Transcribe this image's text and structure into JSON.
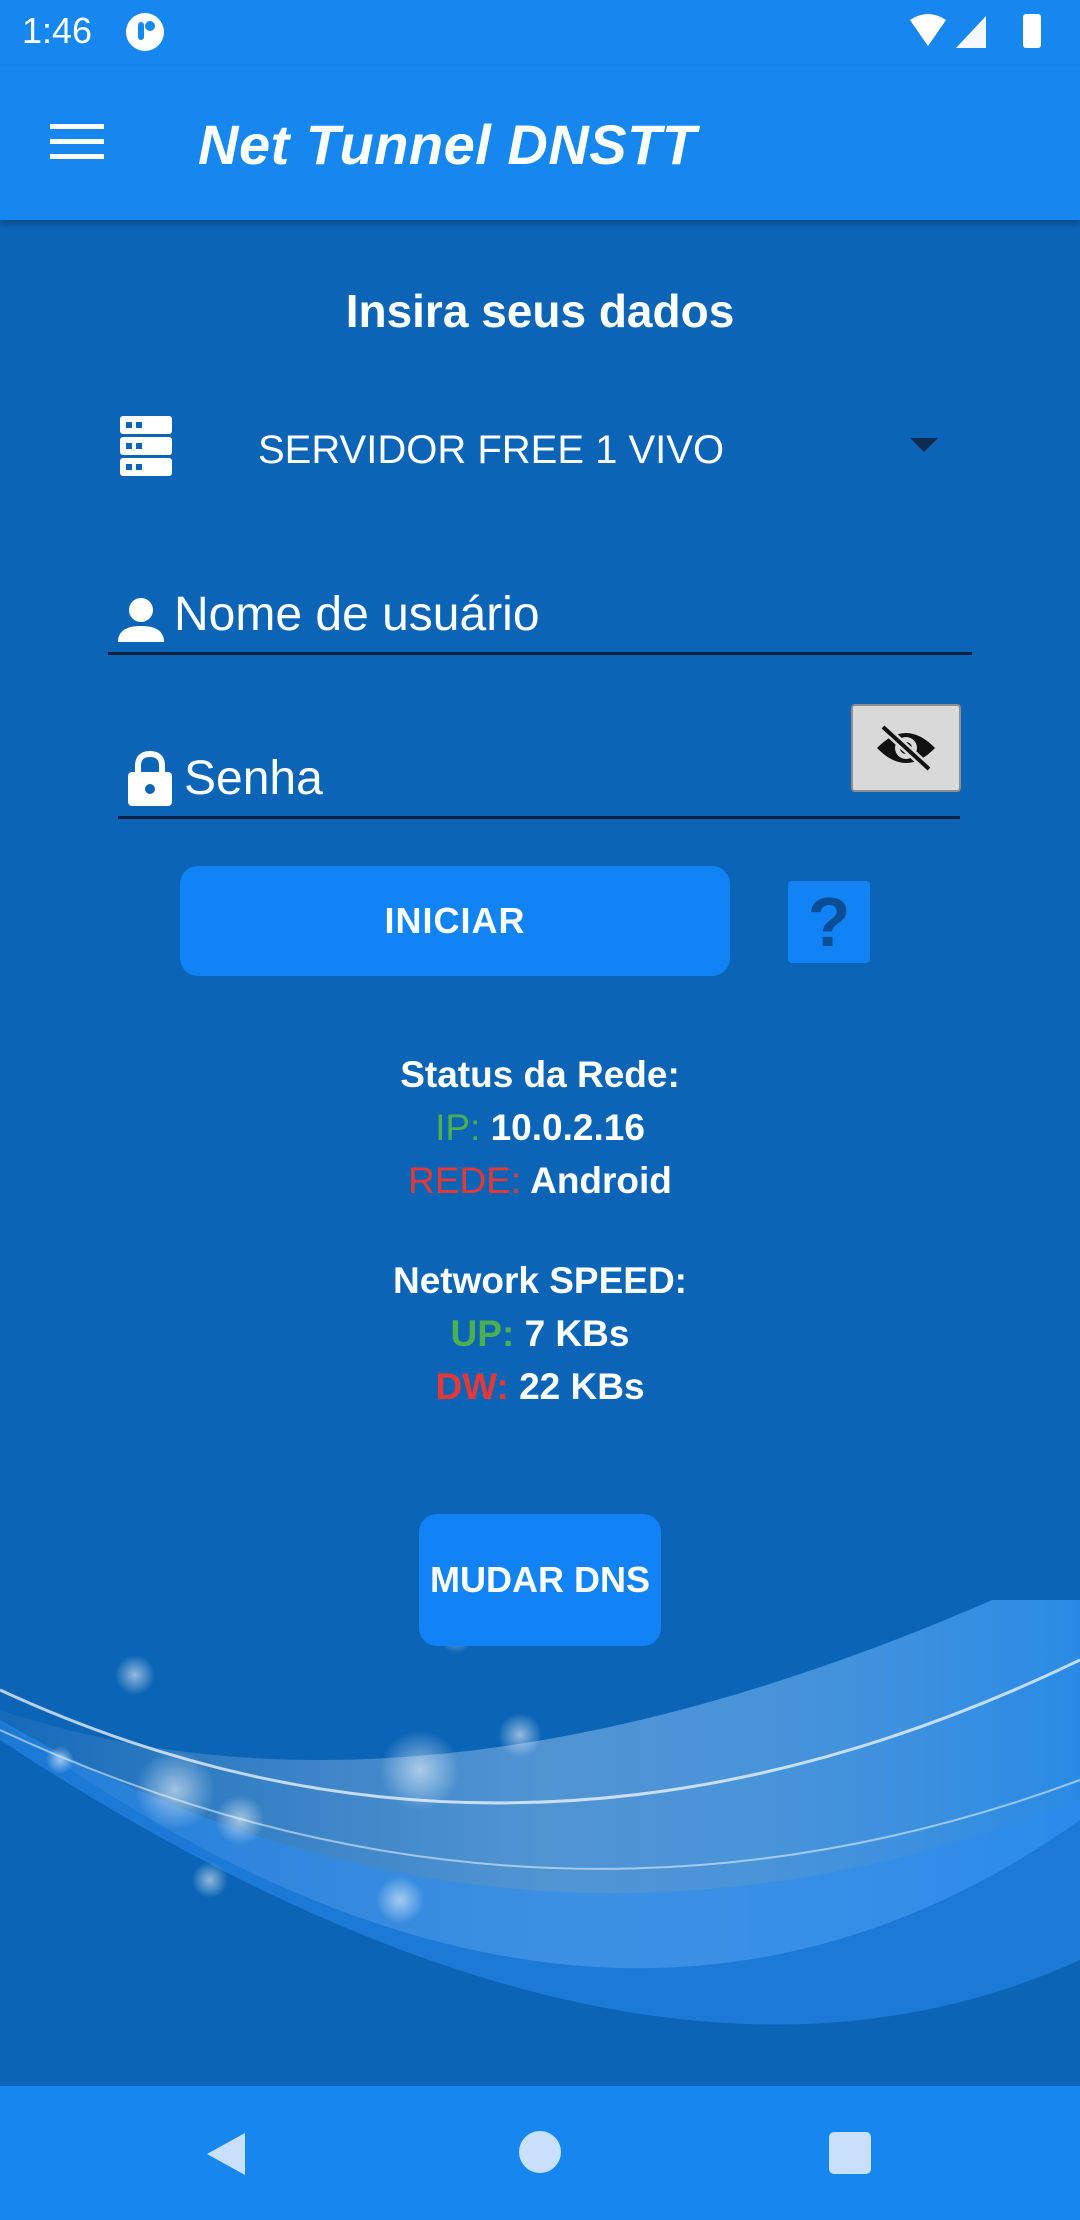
{
  "status_bar": {
    "time": "1:46"
  },
  "app_bar": {
    "title": "Net Tunnel DNSTT",
    "menu_icon": "hamburger-menu-icon"
  },
  "form": {
    "heading": "Insira seus dados",
    "server": {
      "icon": "server-icon",
      "selected": "SERVIDOR FREE 1 VIVO"
    },
    "username": {
      "icon": "person-icon",
      "placeholder": "Nome de usuário",
      "value": ""
    },
    "password": {
      "icon": "lock-icon",
      "placeholder": "Senha",
      "value": "",
      "toggle_icon": "eye-off-icon"
    },
    "start_button": "INICIAR",
    "help_button": "?"
  },
  "network_status": {
    "title": "Status da Rede:",
    "ip_label": "IP:",
    "ip_value": "10.0.2.16",
    "network_label": "REDE:",
    "network_value": "Android"
  },
  "network_speed": {
    "title": "Network SPEED:",
    "up_label": "UP:",
    "up_value": "7 KBs",
    "down_label": "DW:",
    "down_value": "22 KBs"
  },
  "dns_button": "MUDAR DNS",
  "colors": {
    "primary": "#1587ef",
    "background": "#0b64b6",
    "button": "#1283f5",
    "label_green": "#4caf50",
    "label_red": "#e53935"
  },
  "nav_bar": {
    "back_icon": "back-triangle-icon",
    "home_icon": "home-circle-icon",
    "recent_icon": "recents-square-icon"
  }
}
